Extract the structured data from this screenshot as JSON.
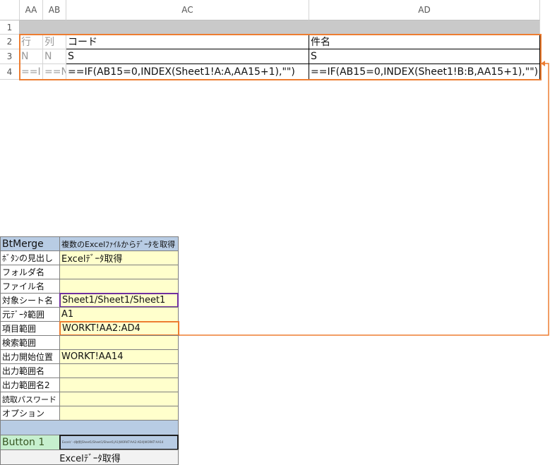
{
  "columns": [
    "AA",
    "AB",
    "AC",
    "AD"
  ],
  "row_numbers": [
    "1",
    "2",
    "3",
    "4"
  ],
  "rows": {
    "r2": {
      "aa": "行",
      "ab": "列",
      "ac": "コード",
      "ad": "件名"
    },
    "r3": {
      "aa": "N",
      "ab": "N",
      "ac": "S",
      "ad": "S"
    },
    "r4": {
      "aa": "==I",
      "ab": "==N",
      "ac": "==IF(AB15=0,INDEX(Sheet1!A:A,AA15+1),\"\")",
      "ad": "==IF(AB15=0,INDEX(Sheet1!B:B,AA15+1),\"\")"
    }
  },
  "panel": {
    "title": "BtMerge",
    "subtitle": "複数のExcelﾌｧｲﾙからﾃﾞｰﾀを取得",
    "fields": [
      {
        "label": "ﾎﾞﾀﾝの見出し",
        "value": "Excelﾃﾞｰﾀ取得"
      },
      {
        "label": "フォルダ名",
        "value": ""
      },
      {
        "label": "ファイル名",
        "value": ""
      },
      {
        "label": "対象シート名",
        "value": "Sheet1/Sheet1/Sheet1"
      },
      {
        "label": "元ﾃﾞｰﾀ範囲",
        "value": "A1"
      },
      {
        "label": "項目範囲",
        "value": "WORKT!AA2:AD4"
      },
      {
        "label": "検索範囲",
        "value": ""
      },
      {
        "label": "出力開始位置",
        "value": "WORKT!AA14"
      },
      {
        "label": "出力範囲名",
        "value": ""
      },
      {
        "label": "出力範囲名2",
        "value": ""
      },
      {
        "label": "読取パスワード",
        "value": ""
      },
      {
        "label": "オプション",
        "value": ""
      }
    ],
    "button_name": "Button 1",
    "button_params": "Excelﾃﾞｰﾀ取得|Sheet1/Sheet1/Sheet1|A1|WORKT!AA2:AD4|WORKT!AA14",
    "button_caption": "Excelﾃﾞｰﾀ取得"
  },
  "colors": {
    "highlight_orange": "#ed7d31",
    "highlight_purple": "#7030a0",
    "input_yellow": "#ffffcc",
    "header_blue": "#b8cce4"
  }
}
